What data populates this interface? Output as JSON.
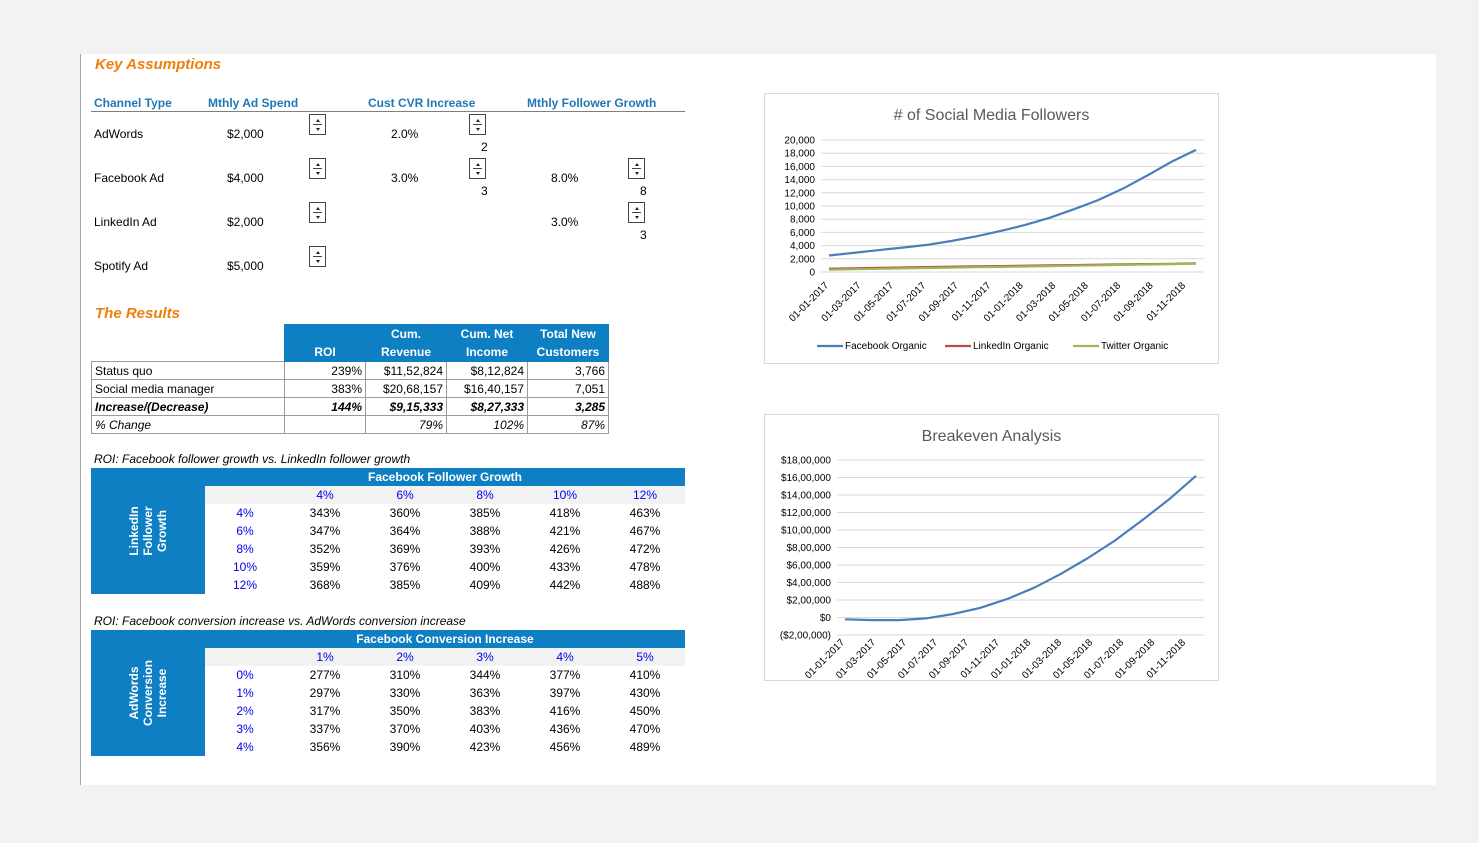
{
  "assumptions": {
    "title": "Key Assumptions",
    "headers": [
      "Channel Type",
      "Mthly Ad Spend",
      "Cust CVR Increase",
      "Mthly Follower Growth"
    ],
    "rows": [
      {
        "channel": "AdWords",
        "spend": "$2,000",
        "cvr": "2.0%",
        "cvr_spin": "2",
        "growth": "",
        "growth_spin": ""
      },
      {
        "channel": "Facebook Ad",
        "spend": "$4,000",
        "cvr": "3.0%",
        "cvr_spin": "3",
        "growth": "8.0%",
        "growth_spin": "8"
      },
      {
        "channel": "LinkedIn Ad",
        "spend": "$2,000",
        "cvr": "",
        "cvr_spin": "",
        "growth": "3.0%",
        "growth_spin": "3"
      },
      {
        "channel": "Spotify Ad",
        "spend": "$5,000",
        "cvr": "",
        "cvr_spin": "",
        "growth": "",
        "growth_spin": ""
      }
    ]
  },
  "results": {
    "title": "The Results",
    "headers": [
      {
        "line1": "",
        "line2": "ROI"
      },
      {
        "line1": "Cum.",
        "line2": "Revenue"
      },
      {
        "line1": "Cum. Net",
        "line2": "Income"
      },
      {
        "line1": "Total New",
        "line2": "Customers"
      }
    ],
    "rows": [
      {
        "label": "Status quo",
        "roi": "239%",
        "revenue": "$11,52,824",
        "income": "$8,12,824",
        "customers": "3,766"
      },
      {
        "label": "Social media manager",
        "roi": "383%",
        "revenue": "$20,68,157",
        "income": "$16,40,157",
        "customers": "7,051"
      },
      {
        "label": "Increase/(Decrease)",
        "roi": "144%",
        "revenue": "$9,15,333",
        "income": "$8,27,333",
        "customers": "3,285"
      },
      {
        "label": "% Change",
        "roi": "",
        "revenue": "79%",
        "income": "102%",
        "customers": "87%"
      }
    ]
  },
  "sensitivity1": {
    "caption": "ROI: Facebook follower growth vs. LinkedIn follower growth",
    "col_title": "Facebook Follower Growth",
    "row_title_lines": [
      "LinkedIn",
      "Follower",
      "Growth"
    ],
    "cols": [
      "4%",
      "6%",
      "8%",
      "10%",
      "12%"
    ],
    "rows": [
      {
        "label": "4%",
        "values": [
          "343%",
          "360%",
          "385%",
          "418%",
          "463%"
        ]
      },
      {
        "label": "6%",
        "values": [
          "347%",
          "364%",
          "388%",
          "421%",
          "467%"
        ]
      },
      {
        "label": "8%",
        "values": [
          "352%",
          "369%",
          "393%",
          "426%",
          "472%"
        ]
      },
      {
        "label": "10%",
        "values": [
          "359%",
          "376%",
          "400%",
          "433%",
          "478%"
        ]
      },
      {
        "label": "12%",
        "values": [
          "368%",
          "385%",
          "409%",
          "442%",
          "488%"
        ]
      }
    ]
  },
  "sensitivity2": {
    "caption": "ROI: Facebook conversion increase vs. AdWords conversion increase",
    "col_title": "Facebook Conversion Increase",
    "row_title_lines": [
      "AdWords",
      "Conversion",
      "Increase"
    ],
    "cols": [
      "1%",
      "2%",
      "3%",
      "4%",
      "5%"
    ],
    "rows": [
      {
        "label": "0%",
        "values": [
          "277%",
          "310%",
          "344%",
          "377%",
          "410%"
        ]
      },
      {
        "label": "1%",
        "values": [
          "297%",
          "330%",
          "363%",
          "397%",
          "430%"
        ]
      },
      {
        "label": "2%",
        "values": [
          "317%",
          "350%",
          "383%",
          "416%",
          "450%"
        ]
      },
      {
        "label": "3%",
        "values": [
          "337%",
          "370%",
          "403%",
          "436%",
          "470%"
        ]
      },
      {
        "label": "4%",
        "values": [
          "356%",
          "390%",
          "423%",
          "456%",
          "489%"
        ]
      }
    ]
  },
  "chart_data": [
    {
      "type": "line",
      "title": "# of Social Media Followers",
      "xlabel": "",
      "ylabel": "",
      "x_tick_labels": [
        "01-01-2017",
        "01-03-2017",
        "01-05-2017",
        "01-07-2017",
        "01-09-2017",
        "01-11-2017",
        "01-01-2018",
        "01-03-2018",
        "01-05-2018",
        "01-07-2018",
        "01-09-2018",
        "01-11-2018"
      ],
      "y_tick_labels": [
        "0",
        "2,000",
        "4,000",
        "6,000",
        "8,000",
        "10,000",
        "12,000",
        "14,000",
        "16,000",
        "18,000",
        "20,000"
      ],
      "ylim": [
        0,
        20000
      ],
      "grid": true,
      "legend": "bottom",
      "series": [
        {
          "name": "Facebook Organic",
          "color": "#4a7ebb",
          "values": [
            2500,
            2900,
            3300,
            3700,
            4100,
            4700,
            5400,
            6200,
            7100,
            8200,
            9500,
            10900,
            12600,
            14600,
            16700,
            18500
          ]
        },
        {
          "name": "LinkedIn Organic",
          "color": "#be4b48",
          "values": [
            500,
            560,
            620,
            680,
            740,
            800,
            850,
            900,
            950,
            1000,
            1050,
            1100,
            1150,
            1200,
            1250,
            1300
          ]
        },
        {
          "name": "Twitter Organic",
          "color": "#98b954",
          "values": [
            350,
            420,
            480,
            540,
            600,
            660,
            720,
            780,
            840,
            900,
            960,
            1020,
            1080,
            1140,
            1200,
            1260
          ]
        }
      ]
    },
    {
      "type": "line",
      "title": "Breakeven Analysis",
      "xlabel": "",
      "ylabel": "",
      "x_tick_labels": [
        "01-01-2017",
        "01-03-2017",
        "01-05-2017",
        "01-07-2017",
        "01-09-2017",
        "01-11-2017",
        "01-01-2018",
        "01-03-2018",
        "01-05-2018",
        "01-07-2018",
        "01-09-2018",
        "01-11-2018"
      ],
      "y_tick_labels": [
        "($2,00,000)",
        "$0",
        "$2,00,000",
        "$4,00,000",
        "$6,00,000",
        "$8,00,000",
        "$10,00,000",
        "$12,00,000",
        "$14,00,000",
        "$16,00,000",
        "$18,00,000"
      ],
      "ylim": [
        -200000,
        1800000
      ],
      "grid": true,
      "legend": "none",
      "series": [
        {
          "name": "",
          "color": "#4a7ebb",
          "values": [
            -20000,
            -30000,
            -30000,
            -10000,
            40000,
            110000,
            210000,
            340000,
            500000,
            680000,
            880000,
            1110000,
            1350000,
            1620000
          ]
        }
      ]
    }
  ]
}
